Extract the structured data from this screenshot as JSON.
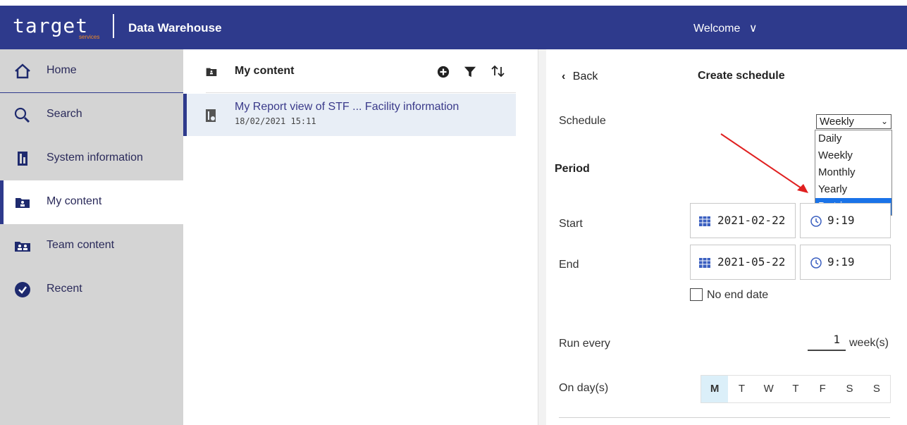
{
  "header": {
    "logo_text": "target",
    "logo_sub": "services",
    "app_title": "Data Warehouse",
    "welcome_label": "Welcome"
  },
  "sidebar": {
    "items": [
      {
        "label": "Home",
        "icon": "home-icon"
      },
      {
        "label": "Search",
        "icon": "search-icon"
      },
      {
        "label": "System information",
        "icon": "report-icon"
      },
      {
        "label": "My content",
        "icon": "folder-user-icon",
        "active": true
      },
      {
        "label": "Team content",
        "icon": "team-folder-icon"
      },
      {
        "label": "Recent",
        "icon": "recent-icon"
      }
    ]
  },
  "content": {
    "title": "My content",
    "rows": [
      {
        "title": "My Report view of STF ... Facility information",
        "date": "18/02/2021 15:11"
      }
    ]
  },
  "panel": {
    "back_label": "Back",
    "title": "Create schedule",
    "schedule_label": "Schedule",
    "schedule_value": "Weekly",
    "schedule_options": [
      "Daily",
      "Weekly",
      "Monthly",
      "Yearly",
      "By trigger"
    ],
    "highlighted_option": "By trigger",
    "period_label": "Period",
    "start_label": "Start",
    "start_date": "2021-02-22",
    "start_time": "9:19",
    "end_label": "End",
    "end_date": "2021-05-22",
    "end_time": "9:19",
    "no_end_date_label": "No end date",
    "run_every_label": "Run every",
    "run_every_value": "1",
    "run_every_unit": "week(s)",
    "on_days_label": "On day(s)",
    "days": [
      "M",
      "T",
      "W",
      "T",
      "F",
      "S",
      "S"
    ],
    "selected_day": "M"
  },
  "colors": {
    "brand": "#2e3a8c",
    "sidebar_bg": "#d4d4d4",
    "selection": "#1a73e8",
    "annotation_arrow": "#e02020"
  }
}
